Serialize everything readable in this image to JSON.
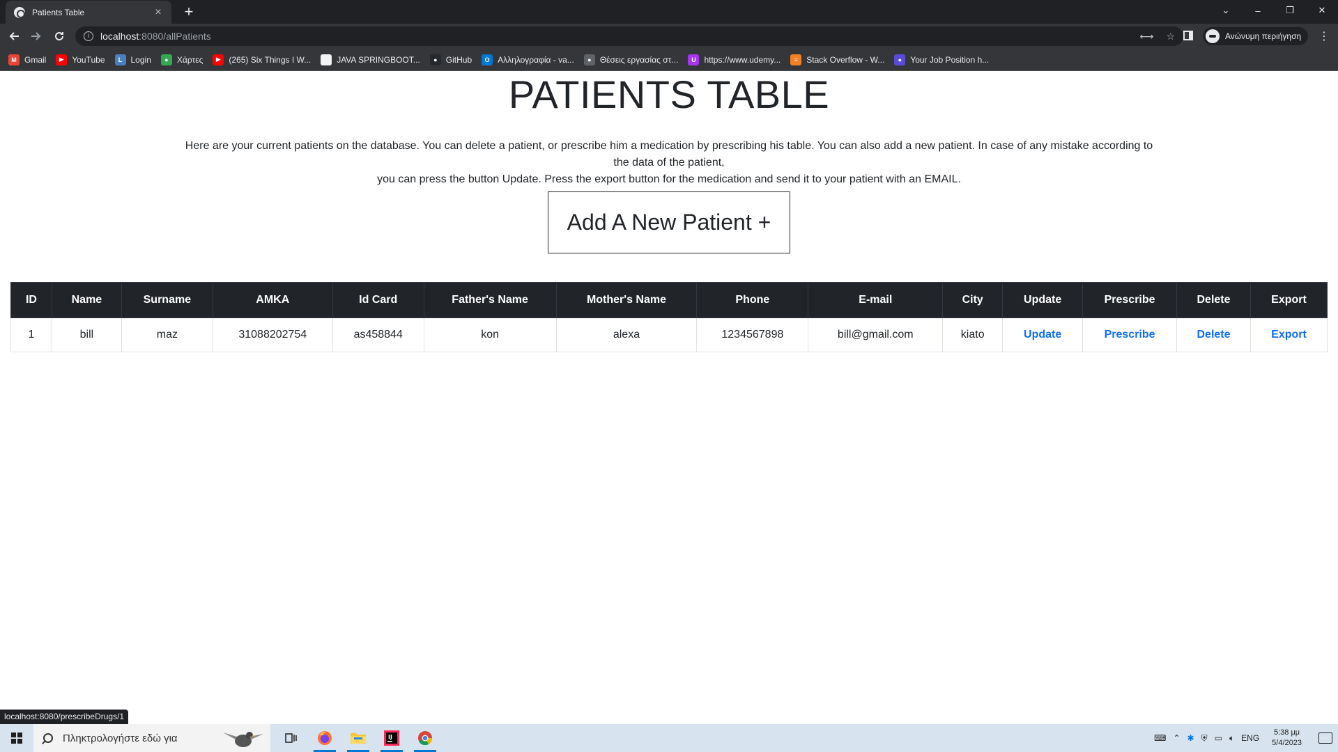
{
  "browser": {
    "tab_title": "Patients Table",
    "tab_close": "×",
    "new_tab": "+",
    "url_host": "localhost",
    "url_rest": ":8080/allPatients",
    "profile_label": "Ανώνυμη περιήγηση",
    "status_url": "localhost:8080/prescribeDrugs/1",
    "window_controls": [
      "⌄",
      "–",
      "❐",
      "✕"
    ],
    "bookmarks": [
      {
        "label": "Gmail",
        "icon": "gmail-icon",
        "color": "#ea4335",
        "glyph": "M"
      },
      {
        "label": "YouTube",
        "icon": "youtube-icon",
        "color": "#ff0000",
        "glyph": "▶"
      },
      {
        "label": "Login",
        "icon": "login-icon",
        "color": "#4a7fc1",
        "glyph": "L"
      },
      {
        "label": "Χάρτες",
        "icon": "maps-icon",
        "color": "#34a853",
        "glyph": "●"
      },
      {
        "label": "(265) Six Things I W...",
        "icon": "youtube-icon",
        "color": "#ff0000",
        "glyph": "▶"
      },
      {
        "label": "JAVA SPRINGBOOT...",
        "icon": "page-icon",
        "color": "#f1f3f4",
        "glyph": ""
      },
      {
        "label": "GitHub",
        "icon": "github-icon",
        "color": "#24292e",
        "glyph": "●"
      },
      {
        "label": "Αλληλογραφία - va...",
        "icon": "outlook-icon",
        "color": "#0078d4",
        "glyph": "O"
      },
      {
        "label": "Θέσεις εργασίας στ...",
        "icon": "apple-icon",
        "color": "#5f6368",
        "glyph": "●"
      },
      {
        "label": "https://www.udemy...",
        "icon": "udemy-icon",
        "color": "#a435f0",
        "glyph": "U"
      },
      {
        "label": "Stack Overflow - W...",
        "icon": "stackoverflow-icon",
        "color": "#f48024",
        "glyph": "≡"
      },
      {
        "label": "Your Job Position h...",
        "icon": "job-icon",
        "color": "#5b4bdb",
        "glyph": "●"
      }
    ]
  },
  "page": {
    "title": "PATIENTS TABLE",
    "description_line1": "Here are your current patients on the database. You can delete a patient, or prescribe him a medication by prescribing his table. You can also add a new patient. In case of any mistake according to the data of the patient,",
    "description_line2": "you can press the button Update. Press the export button for the medication and send it to your patient with an EMAIL.",
    "add_button": "Add A New Patient +"
  },
  "table": {
    "headers": [
      "ID",
      "Name",
      "Surname",
      "AMKA",
      "Id Card",
      "Father's Name",
      "Mother's Name",
      "Phone",
      "E-mail",
      "City",
      "Update",
      "Prescribe",
      "Delete",
      "Export"
    ],
    "rows": [
      {
        "id": "1",
        "name": "bill",
        "surname": "maz",
        "amka": "31088202754",
        "id_card": "as458844",
        "father": "kon",
        "mother": "alexa",
        "phone": "1234567898",
        "email": "bill@gmail.com",
        "city": "kiato",
        "update": "Update",
        "prescribe": "Prescribe",
        "delete": "Delete",
        "export": "Export"
      }
    ]
  },
  "taskbar": {
    "search_placeholder": "Πληκτρολογήστε εδώ για",
    "language": "ENG",
    "time": "5:38 μμ",
    "date": "5/4/2023"
  },
  "colors": {
    "link": "#0d6efd",
    "table_header": "#212529",
    "chrome_dark": "#202124"
  }
}
